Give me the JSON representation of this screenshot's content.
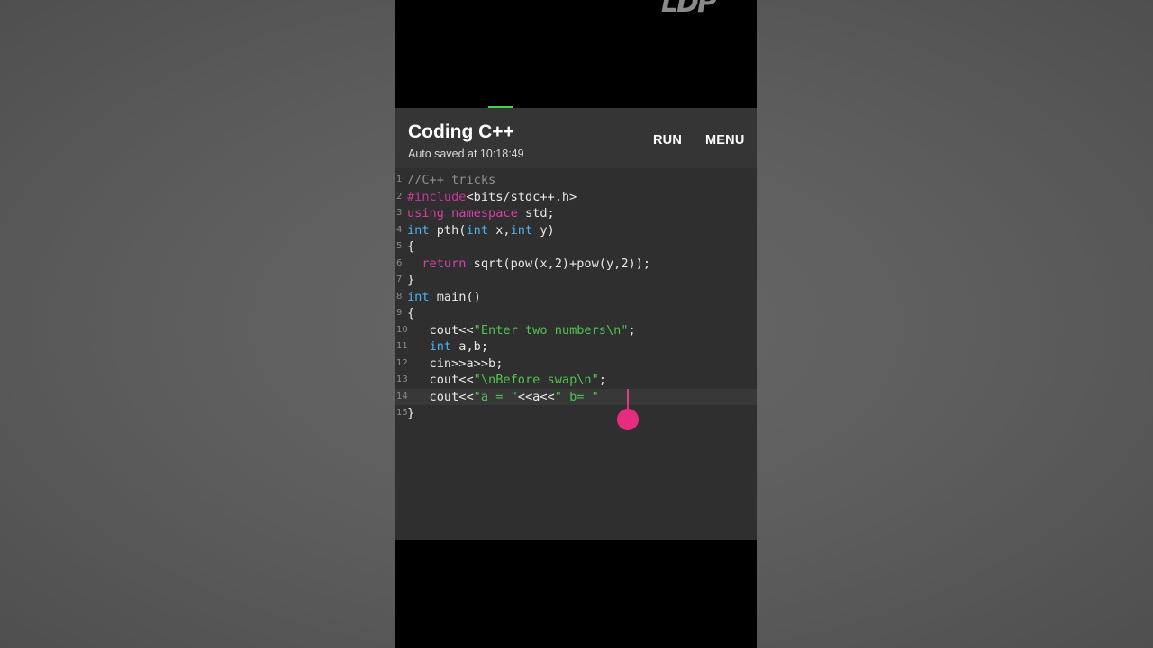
{
  "watermark": {
    "text": "LDP"
  },
  "header": {
    "title": "Coding C++",
    "subtitle": "Auto saved at 10:18:49",
    "run_label": "RUN",
    "menu_label": "MENU"
  },
  "editor": {
    "lines": [
      {
        "num": "1",
        "tokens": [
          {
            "t": "//C++ tricks",
            "c": "comment"
          }
        ]
      },
      {
        "num": "2",
        "tokens": [
          {
            "t": "#include",
            "c": "pre"
          },
          {
            "t": "<bits/stdc++.h>",
            "c": "plain"
          }
        ]
      },
      {
        "num": "3",
        "tokens": [
          {
            "t": "using",
            "c": "kw"
          },
          {
            "t": " ",
            "c": "plain"
          },
          {
            "t": "namespace",
            "c": "kw"
          },
          {
            "t": " std;",
            "c": "plain"
          }
        ]
      },
      {
        "num": "4",
        "tokens": [
          {
            "t": "int",
            "c": "type"
          },
          {
            "t": " pth(",
            "c": "plain"
          },
          {
            "t": "int",
            "c": "type"
          },
          {
            "t": " x,",
            "c": "plain"
          },
          {
            "t": "int",
            "c": "type"
          },
          {
            "t": " y)",
            "c": "plain"
          }
        ]
      },
      {
        "num": "5",
        "tokens": [
          {
            "t": "{",
            "c": "plain"
          }
        ]
      },
      {
        "num": "6",
        "tokens": [
          {
            "t": "  ",
            "c": "plain"
          },
          {
            "t": "return",
            "c": "kw"
          },
          {
            "t": " sqrt(pow(x,2)+pow(y,2));",
            "c": "plain"
          }
        ]
      },
      {
        "num": "7",
        "tokens": [
          {
            "t": "}",
            "c": "plain"
          }
        ]
      },
      {
        "num": "8",
        "tokens": [
          {
            "t": "int",
            "c": "type"
          },
          {
            "t": " main()",
            "c": "plain"
          }
        ]
      },
      {
        "num": "9",
        "tokens": [
          {
            "t": "{",
            "c": "plain"
          }
        ]
      },
      {
        "num": "10",
        "tokens": [
          {
            "t": "   cout<<",
            "c": "plain"
          },
          {
            "t": "\"Enter two numbers\\n\"",
            "c": "str"
          },
          {
            "t": ";",
            "c": "plain"
          }
        ]
      },
      {
        "num": "11",
        "tokens": [
          {
            "t": "   ",
            "c": "plain"
          },
          {
            "t": "int",
            "c": "type"
          },
          {
            "t": " a,b;",
            "c": "plain"
          }
        ]
      },
      {
        "num": "12",
        "tokens": [
          {
            "t": "   cin>>a>>b;",
            "c": "plain"
          }
        ]
      },
      {
        "num": "13",
        "tokens": [
          {
            "t": "   cout<<",
            "c": "plain"
          },
          {
            "t": "\"\\nBefore swap\\n\"",
            "c": "str"
          },
          {
            "t": ";",
            "c": "plain"
          }
        ]
      },
      {
        "num": "14",
        "tokens": [
          {
            "t": "   cout<<",
            "c": "plain"
          },
          {
            "t": "\"a = \"",
            "c": "str"
          },
          {
            "t": "<<a<<",
            "c": "plain"
          },
          {
            "t": "\" b= \"",
            "c": "str"
          }
        ]
      },
      {
        "num": "15",
        "tokens": [
          {
            "t": "}",
            "c": "plain"
          }
        ]
      }
    ],
    "active_line": 14
  },
  "colors": {
    "accent_cursor": "#e62c7f",
    "comment": "#8e8e8e",
    "preprocessor": "#c9359a",
    "keyword": "#d540a8",
    "type": "#4db0ec",
    "string": "#4fc24f",
    "progress": "#3fd44a"
  }
}
